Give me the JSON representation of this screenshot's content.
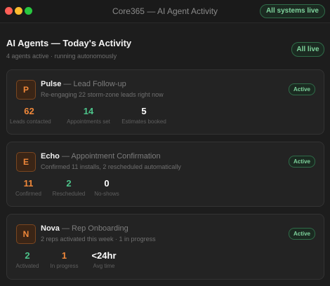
{
  "window": {
    "title": "Core365 — AI Agent Activity",
    "system_status": "All systems live"
  },
  "header": {
    "title": "AI Agents — Today's Activity",
    "subtitle": "4 agents active · running autonomously",
    "live_badge": "All live"
  },
  "colors": {
    "accent_orange": "#f0883a",
    "accent_green": "#4cc38a",
    "badge_green": "#7fd49d"
  },
  "agents": [
    {
      "initial": "P",
      "name": "Pulse",
      "separator": " — ",
      "role": "Lead Follow-up",
      "detail": "Re-engaging 22 storm-zone leads right now",
      "status": "Active",
      "stats": [
        {
          "value": "62",
          "label": "Leads contacted"
        },
        {
          "value": "14",
          "label": "Appointments set"
        },
        {
          "value": "5",
          "label": "Estimates booked"
        }
      ]
    },
    {
      "initial": "E",
      "name": "Echo",
      "separator": " — ",
      "role": "Appointment Confirmation",
      "detail": "Confirmed 11 installs, 2 rescheduled automatically",
      "status": "Active",
      "stats": [
        {
          "value": "11",
          "label": "Confirmed"
        },
        {
          "value": "2",
          "label": "Rescheduled"
        },
        {
          "value": "0",
          "label": "No-shows"
        }
      ]
    },
    {
      "initial": "N",
      "name": "Nova",
      "separator": " — ",
      "role": "Rep Onboarding",
      "detail": "2 reps activated this week · 1 in progress",
      "status": "Active",
      "stats": [
        {
          "value": "2",
          "label": "Activated"
        },
        {
          "value": "1",
          "label": "In progress"
        },
        {
          "value": "<24hr",
          "label": "Avg time"
        }
      ]
    }
  ]
}
